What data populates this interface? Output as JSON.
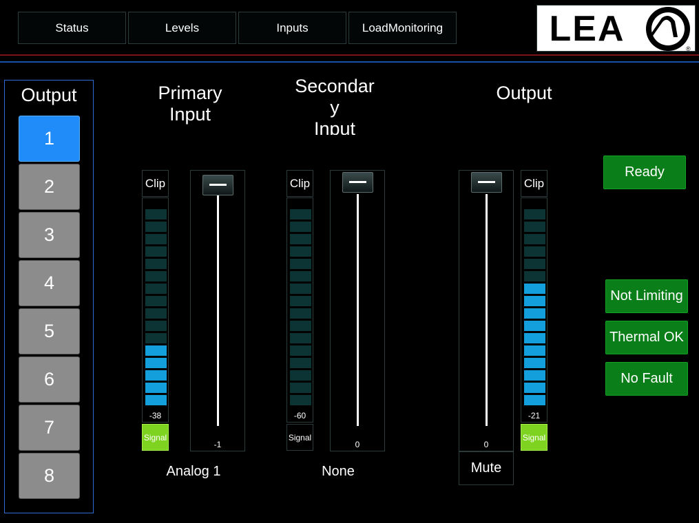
{
  "tabs": [
    {
      "label": "Status"
    },
    {
      "label": "Levels"
    },
    {
      "label": "Inputs"
    },
    {
      "label": "LoadMonitoring"
    }
  ],
  "logo": {
    "text": "LEA",
    "mark": "lea-circle-mark",
    "registered": "®"
  },
  "output_panel": {
    "title": "Output",
    "selected": "1",
    "buttons": [
      {
        "label": "1"
      },
      {
        "label": "2"
      },
      {
        "label": "3"
      },
      {
        "label": "4"
      },
      {
        "label": "5"
      },
      {
        "label": "6"
      },
      {
        "label": "7"
      },
      {
        "label": "8"
      }
    ]
  },
  "sections": {
    "primary": {
      "title_line1": "Primary",
      "title_line2": "Input",
      "clip_label": "Clip",
      "meter_value": "-38",
      "meter_lit_segments": 5,
      "signal_label": "Signal",
      "signal_active": true,
      "fader_value": "-1",
      "source": "Analog 1"
    },
    "secondary": {
      "title_line1": "Secondar",
      "title_line2": "y",
      "title_line3": "Input",
      "clip_label": "Clip",
      "meter_value": "-60",
      "meter_lit_segments": 0,
      "signal_label": "Signal",
      "signal_active": false,
      "fader_value": "0",
      "source": "None"
    },
    "output": {
      "title": "Output",
      "clip_label": "Clip",
      "meter_value": "-21",
      "meter_lit_segments": 10,
      "signal_label": "Signal",
      "signal_active": true,
      "fader_value": "0",
      "mute_label": "Mute"
    }
  },
  "status_indicators": {
    "ready": "Ready",
    "limiting": "Not Limiting",
    "thermal": "Thermal OK",
    "fault": "No Fault"
  },
  "colors": {
    "accent_blue": "#1f8cfa",
    "meter_lit": "#139edc",
    "meter_unlit": "#0c3434",
    "signal_green": "#7ed321",
    "status_green": "#0a7e18",
    "divider_red": "#7f1414",
    "divider_blue": "#1b50a8"
  }
}
